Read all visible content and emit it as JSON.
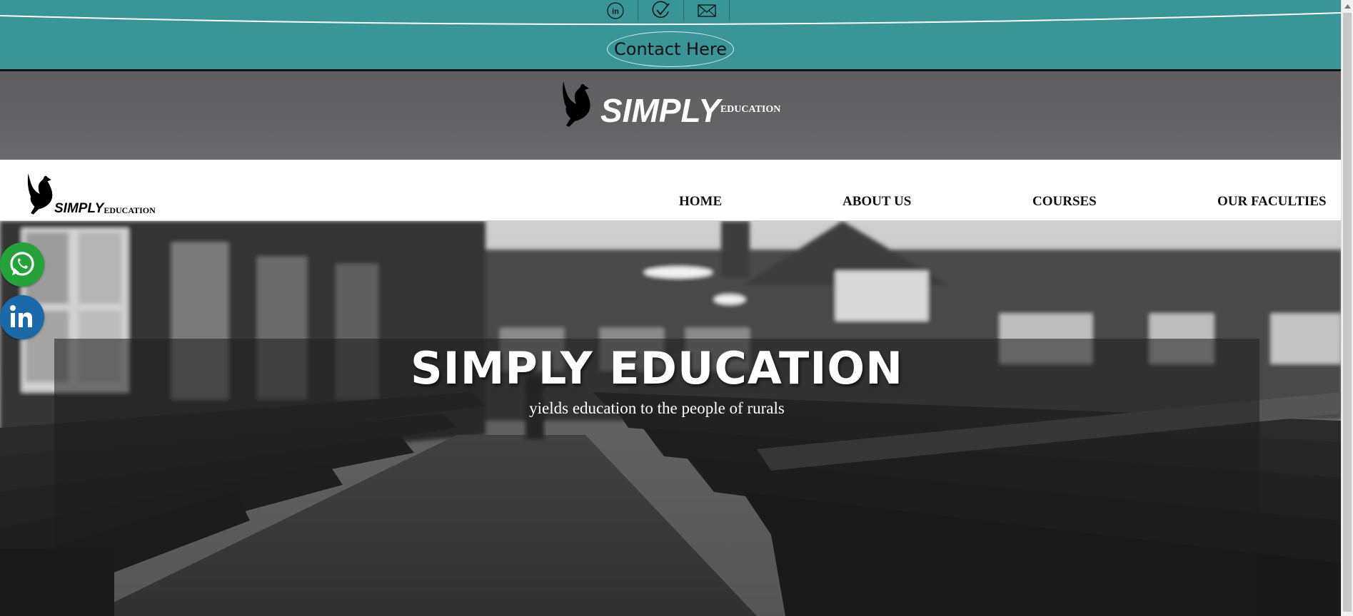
{
  "topbar": {
    "icons": [
      "linkedin-outline-icon",
      "check-icon",
      "mail-icon"
    ],
    "contact_label": "Contact Here"
  },
  "brand": {
    "wordmark": "SIMPLY",
    "suffix": "EDUCATION"
  },
  "nav": {
    "logo_wordmark": "SIMPLY",
    "logo_suffix": "EDUCATION",
    "items": [
      {
        "label": "HOME"
      },
      {
        "label": "ABOUT US"
      },
      {
        "label": "COURSES"
      },
      {
        "label": "OUR FACULTIES"
      }
    ]
  },
  "hero": {
    "title": "SIMPLY EDUCATION",
    "subtitle": "yields education to the people of rurals"
  },
  "floating": {
    "icons": [
      "whatsapp-icon",
      "linkedin-icon"
    ]
  },
  "colors": {
    "teal": "#3a9596",
    "band_grey": "#636264",
    "whatsapp": "#25a33b",
    "linkedin": "#1a69a8"
  }
}
